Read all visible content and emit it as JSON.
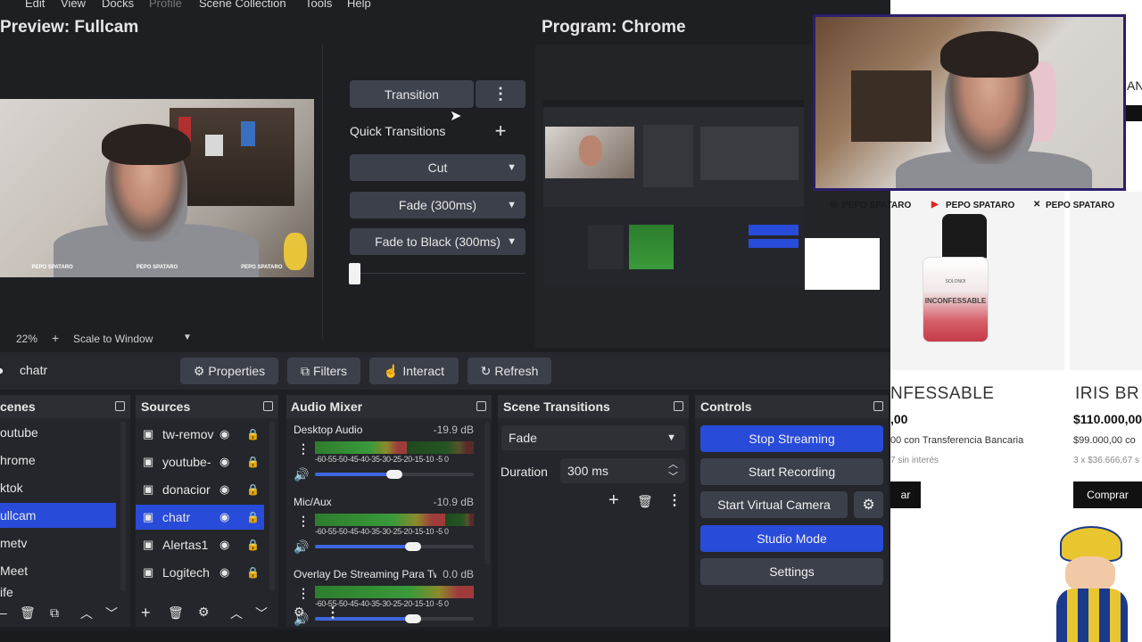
{
  "menu": [
    "Edit",
    "View",
    "Docks",
    "Profile",
    "Scene Collection",
    "Tools",
    "Help"
  ],
  "preview": {
    "title": "Preview: Fullcam",
    "zoom": "22%",
    "scale": "Scale to Window"
  },
  "program": {
    "title": "Program: Chrome"
  },
  "transition_panel": {
    "transition_label": "Transition",
    "quick_label": "Quick Transitions",
    "options": [
      "Cut",
      "Fade (300ms)",
      "Fade to Black (300ms)"
    ]
  },
  "toolbar": {
    "source_name": "chatr",
    "properties": "Properties",
    "filters": "Filters",
    "interact": "Interact",
    "refresh": "Refresh"
  },
  "scenes": {
    "title": "cenes",
    "items": [
      "outube",
      "hrome",
      "ktok",
      "ullcam",
      "metv",
      "Meet",
      "ife"
    ],
    "selected_index": 3
  },
  "sources": {
    "title": "Sources",
    "items": [
      "tw-remov",
      "youtube-",
      "donacior",
      "chatr",
      "Alertas1",
      "Logitech"
    ],
    "selected_index": 3
  },
  "audio": {
    "title": "Audio Mixer",
    "channels": [
      {
        "name": "Desktop Audio",
        "db": "-19.9 dB",
        "level": 0.58
      },
      {
        "name": "Mic/Aux",
        "db": "-10.9 dB",
        "level": 0.82
      },
      {
        "name": "Overlay De Streaming Para Twi",
        "db": "0.0 dB",
        "level": 1.0
      }
    ],
    "scale": "-60-55-50-45-40-35-30-25-20-15-10 -5  0"
  },
  "scene_transitions": {
    "title": "Scene Transitions",
    "selected": "Fade",
    "duration_label": "Duration",
    "duration_value": "300 ms"
  },
  "controls": {
    "title": "Controls",
    "stop_streaming": "Stop Streaming",
    "start_recording": "Start Recording",
    "start_virtual_camera": "Start Virtual Camera",
    "studio_mode": "Studio Mode",
    "settings": "Settings"
  },
  "overlay": {
    "socials": [
      "PEPO SPATARO",
      "PEPO SPATARO",
      "PEPO SPATARO"
    ]
  },
  "web": {
    "product1": {
      "name": "NFESSABLE",
      "price": ",00",
      "transfer": "00 con Transferencia Bancaria",
      "installments": "7 sin interés",
      "button": "ar",
      "bottle_label": "INCONFESSABLE",
      "brand": "SOLONOI"
    },
    "product2": {
      "name": "IRIS BR",
      "price": "$110.000,00",
      "transfer": "$99.000,00 co",
      "installments": "3 x $36.666,67 s",
      "button": "Comprar"
    },
    "side_text": "AN"
  },
  "colors": {
    "accent": "#284bd9",
    "panel": "#24262b",
    "button": "#3c404b",
    "bg": "#1e1f23"
  }
}
